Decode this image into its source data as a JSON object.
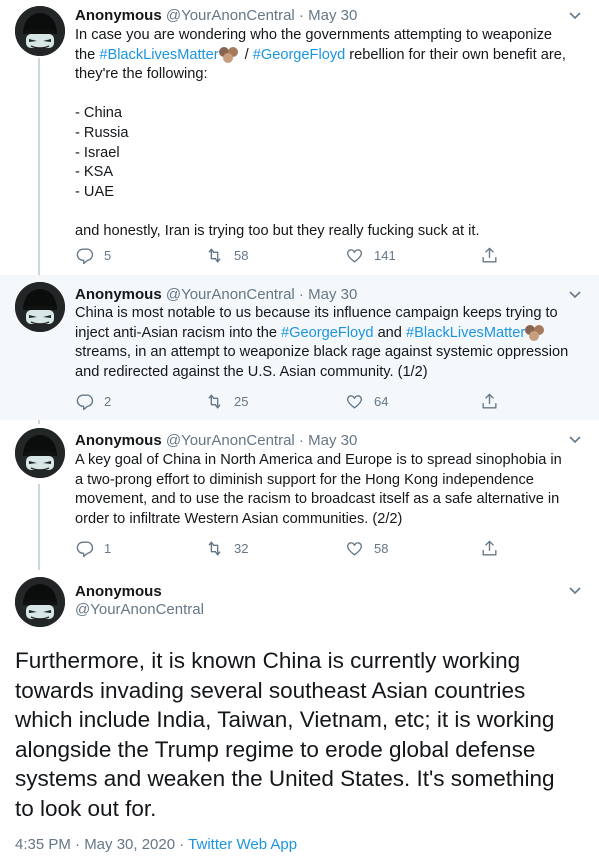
{
  "tweets": [
    {
      "name": "Anonymous",
      "handle": "@YourAnonCentral",
      "date": "May 30",
      "line1": "In case you are wondering who the governments attempting to weaponize",
      "line2_pre": "the ",
      "tag_blm": "#BlackLivesMatter",
      "line2_mid": " / ",
      "tag_gf": "#GeorgeFloyd",
      "line2_post": " rebellion for their own benefit are,",
      "line3": "they're the following:",
      "list": [
        "- China",
        "- Russia",
        "- Israel",
        "- KSA",
        "- UAE"
      ],
      "closing": "and honestly, Iran is trying too but they really fucking suck at it.",
      "replies": "5",
      "retweets": "58",
      "likes": "141"
    },
    {
      "name": "Anonymous",
      "handle": "@YourAnonCentral",
      "date": "May 30",
      "line1": "China is most notable to us because its influence campaign keeps trying to",
      "line2_pre": "inject anti-Asian racism into the ",
      "tag_gf": "#GeorgeFloyd",
      "line2_mid": " and ",
      "tag_blm": "#BlackLivesMatter",
      "line3": " streams, in an attempt to weaponize black rage against systemic oppression",
      "line4": "and redirected against the U.S. Asian community. (1/2)",
      "replies": "2",
      "retweets": "25",
      "likes": "64"
    },
    {
      "name": "Anonymous",
      "handle": "@YourAnonCentral",
      "date": "May 30",
      "lines": [
        "A key goal of China in North America and Europe is to spread sinophobia in",
        "a two-prong effort to diminish support for the Hong Kong independence",
        "movement, and to use the racism to broadcast itself as a safe alternative in",
        "order to infiltrate Western Asian communities. (2/2)"
      ],
      "replies": "1",
      "retweets": "32",
      "likes": "58"
    }
  ],
  "main_tweet": {
    "name": "Anonymous",
    "handle": "@YourAnonCentral",
    "lines": [
      "Furthermore, it is known China is currently working",
      "towards invading several southeast Asian countries",
      "which include India, Taiwan, Vietnam, etc; it is working",
      "alongside the Trump regime to erode global defense",
      "systems and weaken the United States. It's something",
      "to look out for."
    ],
    "timestamp": "4:35 PM · May 30, 2020 · ",
    "source_app": "Twitter Web App"
  },
  "colors": {
    "link": "#1b95e0",
    "secondary_text": "#657786",
    "highlight_bg": "#f5f8fa",
    "thread_line": "#ccd6dd"
  },
  "icons": [
    "reply-icon",
    "retweet-icon",
    "like-icon",
    "share-icon",
    "chevron-down-icon",
    "raised-fist-emoji-icon"
  ]
}
